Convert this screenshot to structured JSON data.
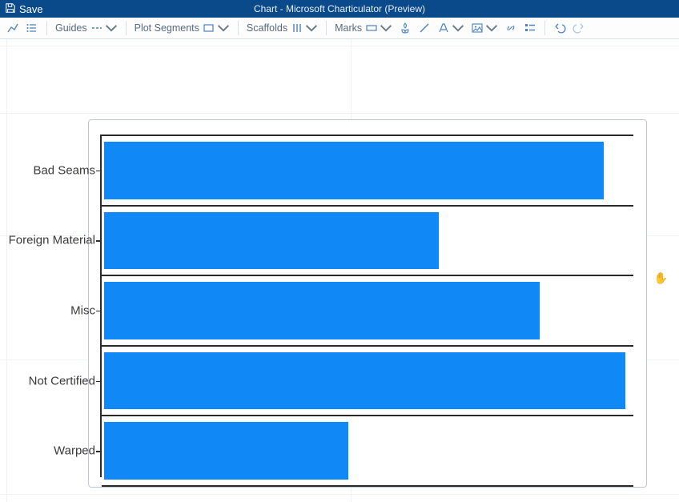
{
  "title_bar": {
    "save_label": "Save",
    "app_title": "Chart - Microsoft Charticulator (Preview)"
  },
  "toolbar": {
    "guides_label": "Guides",
    "plot_segments_label": "Plot Segments",
    "scaffolds_label": "Scaffolds",
    "marks_label": "Marks"
  },
  "chart_data": {
    "type": "bar",
    "orientation": "horizontal",
    "categories": [
      "Bad Seams",
      "Foreign Material",
      "Misc",
      "Not Certified",
      "Warped"
    ],
    "values": [
      94,
      63,
      82,
      98,
      46
    ],
    "bar_color": "#1089f7",
    "x_range": [
      0,
      100
    ]
  }
}
